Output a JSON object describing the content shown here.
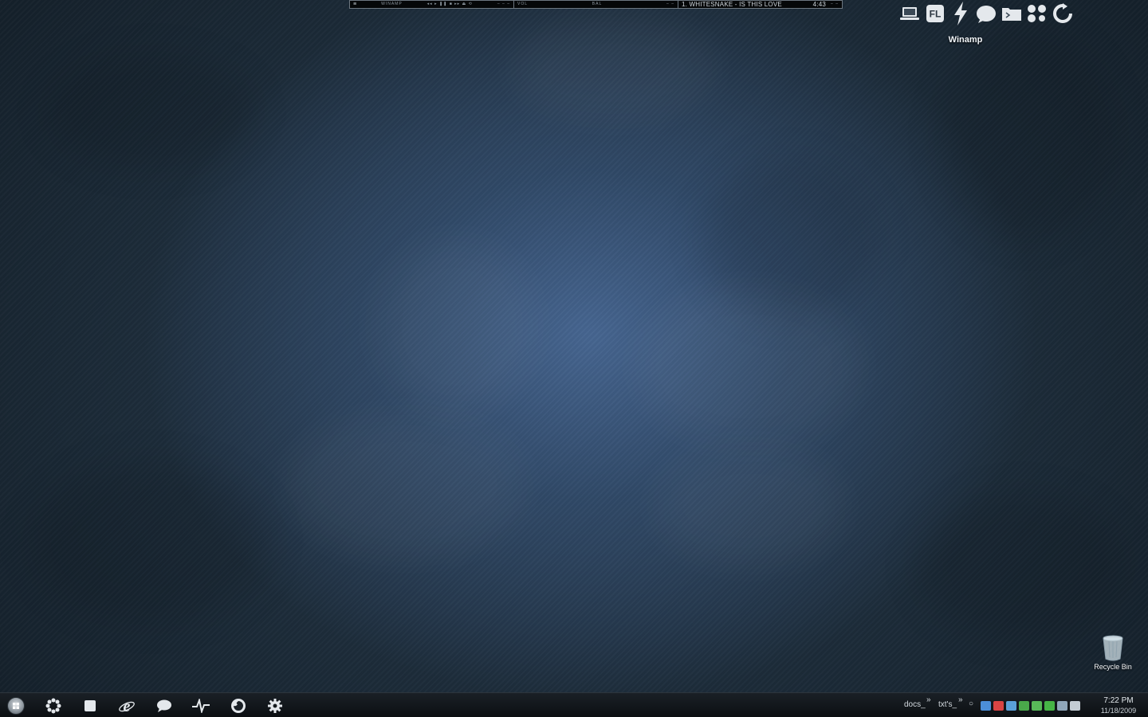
{
  "winamp": {
    "seg1_left": "≡",
    "seg1_title": "WINAMP",
    "seg1_controls": "◂◂ ▸ ❚❚ ■ ▸▸ ⏏ ⟲",
    "seg1_right": "– – –",
    "seg2_left": "VOL",
    "seg2_mid": "BAL",
    "seg2_right": "– –",
    "track": "1. WHITESNAKE - IS THIS LOVE",
    "time": "4:43",
    "seg3_right": "– –"
  },
  "dock": {
    "items": [
      {
        "name": "laptop-icon"
      },
      {
        "name": "fl-studio-icon",
        "text": "FL"
      },
      {
        "name": "winamp-bolt-icon"
      },
      {
        "name": "chat-bubble-icon"
      },
      {
        "name": "folder-icon"
      },
      {
        "name": "network-icon"
      },
      {
        "name": "refresh-icon"
      }
    ],
    "hover_label": "Winamp"
  },
  "desktop": {
    "recycle_bin_label": "Recycle Bin"
  },
  "taskbar": {
    "toolbar1": "docs_",
    "toolbar2": "txt's_",
    "chevron": "»",
    "clock_time": "7:22 PM",
    "clock_date": "11/18/2009",
    "tray_colors": [
      "#4c8ed8",
      "#d84444",
      "#5aa0d8",
      "#4aa84a",
      "#58b858",
      "#46b446",
      "#8fa6ba",
      "#c4ccd4"
    ]
  }
}
